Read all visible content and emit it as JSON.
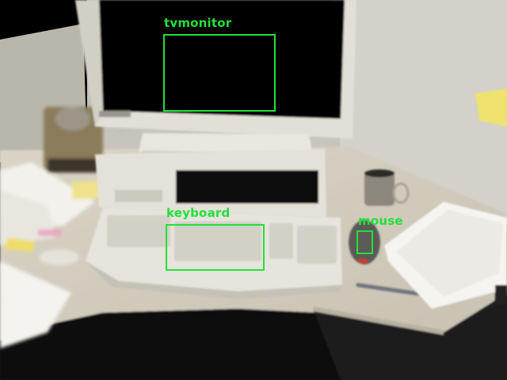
{
  "scene": {
    "description_colors": {
      "wall": "#c9c6bd",
      "desk": "#d6d1c2",
      "monitor_casing": "#e3e1d6",
      "screen": "#050505",
      "keyboard": "#e6e4dc",
      "box_color": "#22e03a"
    }
  },
  "detections": [
    {
      "label": "tvmonitor",
      "box_id": "tvmonitor"
    },
    {
      "label": "keyboard",
      "box_id": "keyboard"
    },
    {
      "label": "mouse",
      "box_id": "mouse"
    }
  ]
}
